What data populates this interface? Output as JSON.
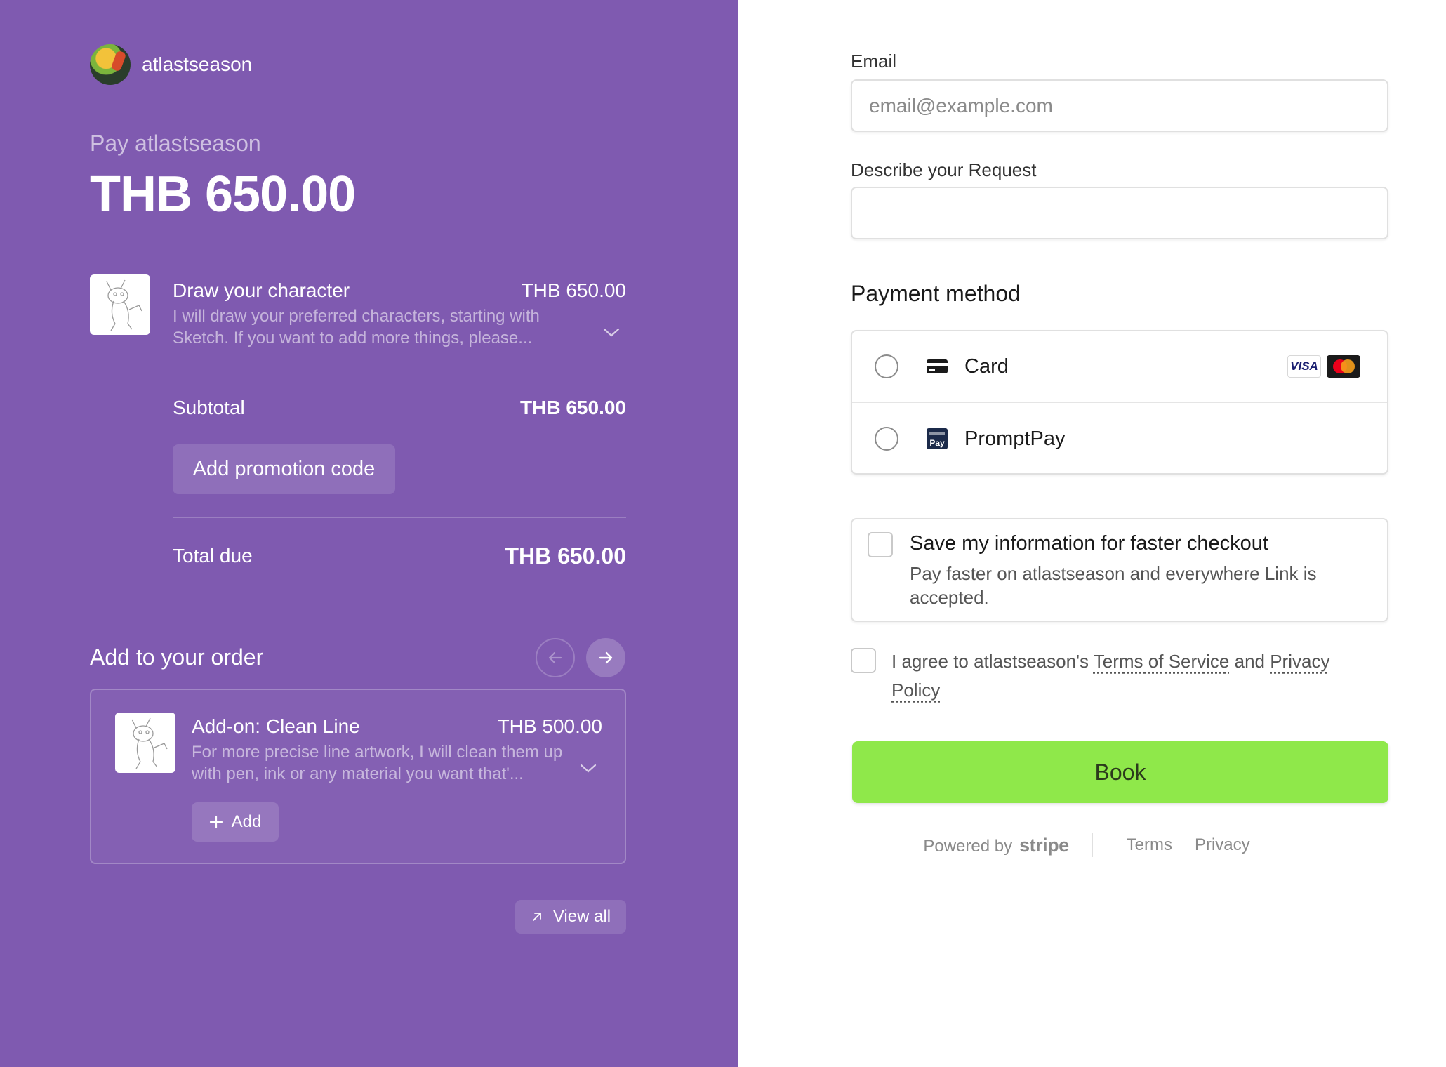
{
  "merchant": {
    "name": "atlastseason"
  },
  "summary": {
    "pay_label": "Pay atlastseason",
    "amount": "THB 650.00"
  },
  "line_item": {
    "title": "Draw your character",
    "price": "THB 650.00",
    "description": "I will draw your preferred characters, starting with Sketch. If you want to add more things, please..."
  },
  "subtotal": {
    "label": "Subtotal",
    "value": "THB 650.00"
  },
  "promo": {
    "label": "Add promotion code"
  },
  "total": {
    "label": "Total due",
    "value": "THB 650.00"
  },
  "add_to_order": {
    "title": "Add to your order",
    "item": {
      "title": "Add-on: Clean Line",
      "price": "THB 500.00",
      "description": "For more precise line artwork, I will clean them up with pen, ink or any material you want that'...",
      "add_label": "Add"
    },
    "view_all_label": "View all"
  },
  "form": {
    "email_label": "Email",
    "email_placeholder": "email@example.com",
    "email_value": "",
    "request_label": "Describe your Request",
    "request_value": ""
  },
  "payment": {
    "title": "Payment method",
    "options": [
      {
        "label": "Card",
        "icon": "card-icon",
        "brands": [
          "VISA",
          "Mastercard"
        ],
        "selected": false
      },
      {
        "label": "PromptPay",
        "icon": "promptpay-icon",
        "selected": false
      }
    ]
  },
  "save_info": {
    "title": "Save my information for faster checkout",
    "description": "Pay faster on atlastseason and everywhere Link is accepted.",
    "checked": false
  },
  "terms": {
    "prefix": "I agree to atlastseason's ",
    "tos": "Terms of Service",
    "and": " and ",
    "privacy": "Privacy Policy",
    "checked": false
  },
  "submit": {
    "label": "Book"
  },
  "footer": {
    "powered_by": "Powered by",
    "stripe": "stripe",
    "terms": "Terms",
    "privacy": "Privacy"
  },
  "colors": {
    "left_panel": "#7f5ab0",
    "book_button": "#8fe84a"
  }
}
